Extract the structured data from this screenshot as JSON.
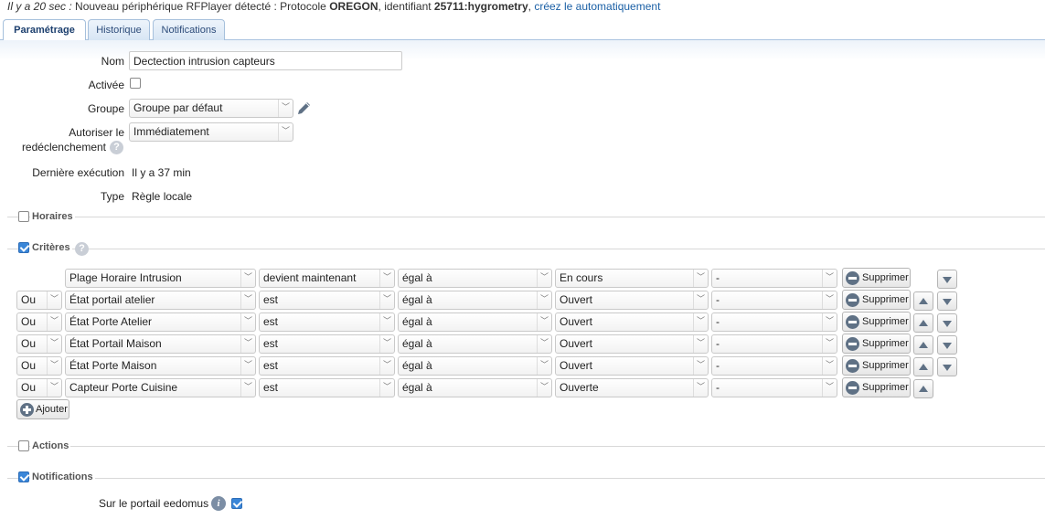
{
  "notification": {
    "time": "Il y a 20 sec :",
    "message": " Nouveau périphérique RFPlayer détecté : Protocole ",
    "protocol": "OREGON",
    "mid": ", identifiant ",
    "identifier": "25711:hygrometry",
    "sep": ", ",
    "link": "créez le automatiquement"
  },
  "tabs": [
    "Paramétrage",
    "Historique",
    "Notifications"
  ],
  "form": {
    "name_label": "Nom",
    "name_value": "Dectection intrusion capteurs",
    "enabled_label": "Activée",
    "group_label": "Groupe",
    "group_value": "Groupe par défaut",
    "retrigger_label_1": "Autoriser le",
    "retrigger_label_2": "redéclenchement",
    "retrigger_value": "Immédiatement",
    "last_exec_label": "Dernière exécution",
    "last_exec_value": "Il y a 37 min",
    "type_label": "Type",
    "type_value": "Règle locale"
  },
  "sections": {
    "horaires": "Horaires",
    "criteres": "Critères",
    "actions": "Actions",
    "notifications": "Notifications"
  },
  "criteria": [
    {
      "logic": "",
      "device": "Plage Horaire Intrusion",
      "condition": "devient maintenant",
      "operator": "égal à",
      "value": "En cours",
      "extra": "-",
      "delete": "Supprimer"
    },
    {
      "logic": "Ou",
      "device": "État portail atelier",
      "condition": "est",
      "operator": "égal à",
      "value": "Ouvert",
      "extra": "-",
      "delete": "Supprimer"
    },
    {
      "logic": "Ou",
      "device": "État Porte Atelier",
      "condition": "est",
      "operator": "égal à",
      "value": "Ouvert",
      "extra": "-",
      "delete": "Supprimer"
    },
    {
      "logic": "Ou",
      "device": "État Portail Maison",
      "condition": "est",
      "operator": "égal à",
      "value": "Ouvert",
      "extra": "-",
      "delete": "Supprimer"
    },
    {
      "logic": "Ou",
      "device": "État Porte Maison",
      "condition": "est",
      "operator": "égal à",
      "value": "Ouvert",
      "extra": "-",
      "delete": "Supprimer"
    },
    {
      "logic": "Ou",
      "device": "Capteur Porte Cuisine",
      "condition": "est",
      "operator": "égal à",
      "value": "Ouverte",
      "extra": "-",
      "delete": "Supprimer"
    }
  ],
  "add_label": "Ajouter",
  "notif_portal_label": "Sur le portail eedomus",
  "colors": {
    "accent": "#3a86d8",
    "link": "#1a5fa5",
    "tab_border": "#a6c0dc"
  }
}
